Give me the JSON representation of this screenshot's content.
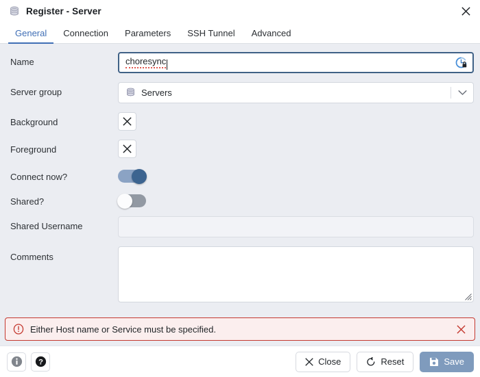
{
  "window": {
    "title": "Register - Server",
    "icon": "server-stack-icon",
    "close_label": "Close window"
  },
  "tabs": [
    {
      "label": "General",
      "active": true
    },
    {
      "label": "Connection",
      "active": false
    },
    {
      "label": "Parameters",
      "active": false
    },
    {
      "label": "SSH Tunnel",
      "active": false
    },
    {
      "label": "Advanced",
      "active": false
    }
  ],
  "form": {
    "name": {
      "label": "Name",
      "value": "choresync",
      "placeholder": "",
      "trailing_icon": "password-manager-lock-icon",
      "focused": true,
      "spellcheck_flagged": true
    },
    "server_group": {
      "label": "Server group",
      "value": "Servers",
      "icon": "server-group-icon",
      "options": [
        "Servers"
      ]
    },
    "background": {
      "label": "Background",
      "button_icon": "clear-color-x-icon",
      "value": ""
    },
    "foreground": {
      "label": "Foreground",
      "button_icon": "clear-color-x-icon",
      "value": ""
    },
    "connect_now": {
      "label": "Connect now?",
      "state": "on"
    },
    "shared": {
      "label": "Shared?",
      "state": "off"
    },
    "shared_username": {
      "label": "Shared Username",
      "value": "",
      "placeholder": "",
      "disabled": true
    },
    "comments": {
      "label": "Comments",
      "value": "",
      "placeholder": ""
    }
  },
  "alert": {
    "icon": "error-exclamation-icon",
    "message": "Either Host name or Service must be specified.",
    "dismiss_label": "Dismiss"
  },
  "footer": {
    "info_icon": "info-icon",
    "help_icon": "help-question-icon",
    "close": {
      "label": "Close",
      "icon": "x-icon"
    },
    "reset": {
      "label": "Reset",
      "icon": "reset-rotate-icon"
    },
    "save": {
      "label": "Save",
      "icon": "floppy-save-icon",
      "disabled": true
    }
  },
  "colors": {
    "accent": "#3f6eb5",
    "focus_border": "#3f6186",
    "toggle_on_track": "#8ba3c4",
    "toggle_on_knob": "#3c6490",
    "toggle_off_track": "#9299a3",
    "error_border": "#c4382f",
    "error_bg": "#fbeeee",
    "save_disabled_bg": "#7f9bbd",
    "page_bg": "#ebedf2"
  }
}
